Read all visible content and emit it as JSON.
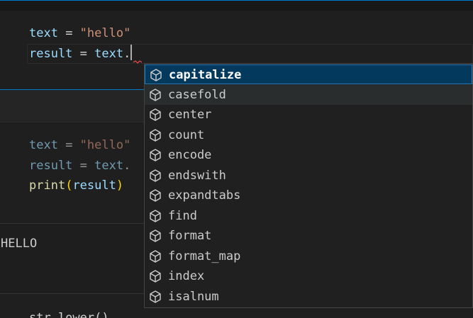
{
  "cell1": {
    "line1": {
      "var": "text",
      "op": " = ",
      "str": "\"hello\""
    },
    "line2": {
      "var": "result",
      "op": " = ",
      "obj": "text",
      "dot": "."
    }
  },
  "cell2": {
    "line1": {
      "var": "text",
      "op": " = ",
      "str": "\"hello\""
    },
    "line2": {
      "var": "result",
      "op": " = ",
      "obj": "text",
      "dot": "."
    },
    "line3": {
      "fn": "print",
      "open": "(",
      "arg": "result",
      "close": ")"
    }
  },
  "output": {
    "text": "HELLO"
  },
  "cell3": {
    "partial": "str.lower()"
  },
  "suggestions": {
    "icon": "cube-icon",
    "items": [
      "capitalize",
      "casefold",
      "center",
      "count",
      "encode",
      "endswith",
      "expandtabs",
      "find",
      "format",
      "format_map",
      "index",
      "isalnum"
    ],
    "selected": "capitalize",
    "hovered": "casefold"
  },
  "colors": {
    "variable": "#9cdcfe",
    "string": "#ce9178",
    "function": "#dcdcaa",
    "bracket": "#ffd700",
    "selection": "#04395e",
    "focus_border": "#007acc",
    "icon": "#cccccc"
  }
}
